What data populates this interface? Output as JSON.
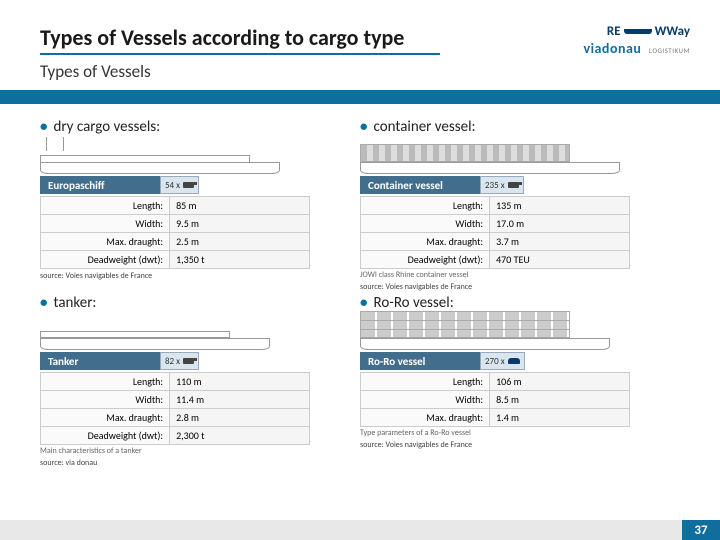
{
  "header": {
    "title": "Types of Vessels according to cargo type",
    "subtitle": "Types of Vessels",
    "logo_rewway_left": "RE",
    "logo_rewway_right": "WWay",
    "logo_viadonau": "viadonau",
    "logo_logistikum": "LOGISTIKUM"
  },
  "bullets": {
    "dot": "•"
  },
  "quads": {
    "dry": {
      "heading": "dry cargo vessels:",
      "bar_name": "Europaschiff",
      "count_label": "54 x",
      "specs": [
        [
          "Length:",
          "85 m"
        ],
        [
          "Width:",
          "9.5 m"
        ],
        [
          "Max. draught:",
          "2.5 m"
        ],
        [
          "Deadweight (dwt):",
          "1,350 t"
        ]
      ],
      "source": "source: Voies navigables de France"
    },
    "container": {
      "heading": "container vessel:",
      "bar_name": "Container vessel",
      "count_label": "235 x",
      "specs": [
        [
          "Length:",
          "135 m"
        ],
        [
          "Width:",
          "17.0 m"
        ],
        [
          "Max. draught:",
          "3.7 m"
        ],
        [
          "Deadweight (dwt):",
          "470 TEU"
        ]
      ],
      "caption": "JOWI class Rhine container vessel",
      "source": "source: Voies navigables de France"
    },
    "tanker": {
      "heading": "tanker:",
      "bar_name": "Tanker",
      "count_label": "82 x",
      "specs": [
        [
          "Length:",
          "110 m"
        ],
        [
          "Width:",
          "11.4 m"
        ],
        [
          "Max. draught:",
          "2.8 m"
        ],
        [
          "Deadweight (dwt):",
          "2,300 t"
        ]
      ],
      "caption": "Main characteristics of a tanker",
      "source": "source: via donau"
    },
    "roro": {
      "heading": "Ro-Ro vessel:",
      "bar_name": "Ro-Ro vessel",
      "count_label": "270 x",
      "specs": [
        [
          "Length:",
          "106 m"
        ],
        [
          "Width:",
          "8.5 m"
        ],
        [
          "Max. draught:",
          "1.4 m"
        ]
      ],
      "caption": "Type parameters of a Ro-Ro vessel",
      "source": "source: Voies navigables de France"
    }
  },
  "page_number": "37"
}
